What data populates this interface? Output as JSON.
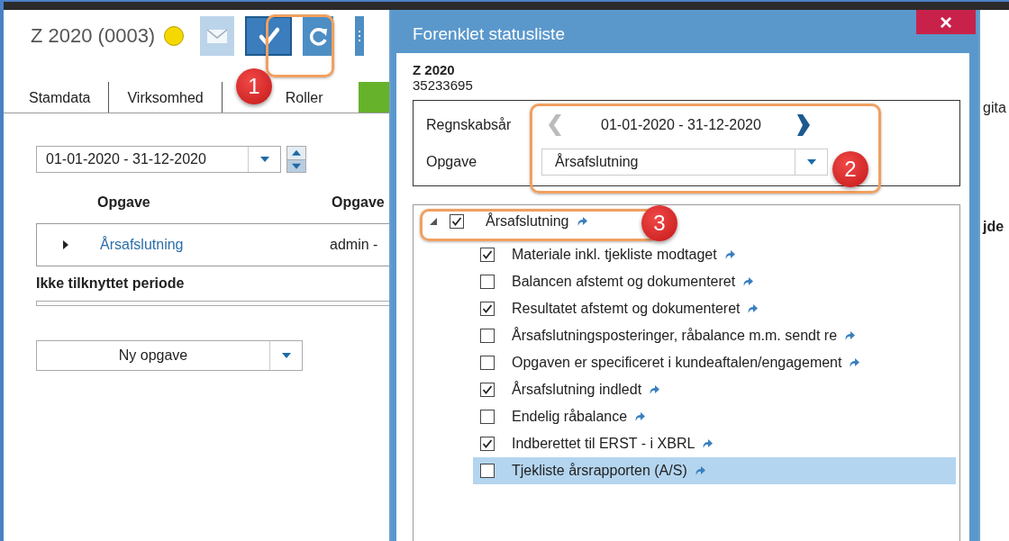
{
  "app": {
    "title": "Z 2020 (0003)",
    "flagged": true,
    "toolbar": [
      {
        "kind": "mail",
        "disabled": true
      },
      {
        "kind": "check",
        "disabled": false
      },
      {
        "kind": "refresh",
        "disabled": false
      },
      {
        "kind": "grip",
        "disabled": false
      }
    ],
    "tabs": [
      {
        "label": "Stamdata",
        "kind": "text"
      },
      {
        "label": "Virksomhed",
        "kind": "text"
      },
      {
        "label": "Roller",
        "kind": "text"
      },
      {
        "kind": "green"
      }
    ],
    "period": {
      "value": "01-01-2020 - 31-12-2020"
    },
    "columns": [
      "Opgave",
      "Opgave"
    ],
    "rows": [
      {
        "cells": [
          "Årsafslutning",
          "admin -"
        ],
        "expanded": false
      }
    ],
    "section": "Ikke tilknyttet periode",
    "new_task": "Ny opgave"
  },
  "behind": [
    "gita",
    "jde"
  ],
  "dialog": {
    "title": "Forenklet statusliste",
    "close": "×",
    "client": "Z 2020",
    "number": "35233695",
    "year_label": "Regnskabsår",
    "year": "01-01-2020 - 31-12-2020",
    "prev_disabled": true,
    "next_disabled": false,
    "task_label": "Opgave",
    "task": "Årsafslutning",
    "tree": {
      "label": "Årsafslutning",
      "checked": true,
      "expanded": true,
      "children": [
        {
          "label": "Materiale inkl. tjekliste modtaget",
          "checked": true,
          "selected": false
        },
        {
          "label": "Balancen afstemt og dokumenteret",
          "checked": false,
          "selected": false
        },
        {
          "label": "Resultatet afstemt og dokumenteret",
          "checked": true,
          "selected": false
        },
        {
          "label": "Årsafslutningsposteringer, råbalance m.m. sendt re",
          "checked": false,
          "selected": false
        },
        {
          "label": "Opgaven er specificeret i kundeaftalen/engagement",
          "checked": false,
          "selected": false
        },
        {
          "label": "Årsafslutning indledt",
          "checked": true,
          "selected": false
        },
        {
          "label": "Endelig råbalance",
          "checked": false,
          "selected": false
        },
        {
          "label": "Indberettet til ERST - i XBRL",
          "checked": true,
          "selected": false
        },
        {
          "label": "Tjekliste årsrapporten (A/S)",
          "checked": false,
          "selected": true
        }
      ]
    }
  },
  "callouts": [
    {
      "number": "1"
    },
    {
      "number": "2"
    },
    {
      "number": "3"
    }
  ]
}
